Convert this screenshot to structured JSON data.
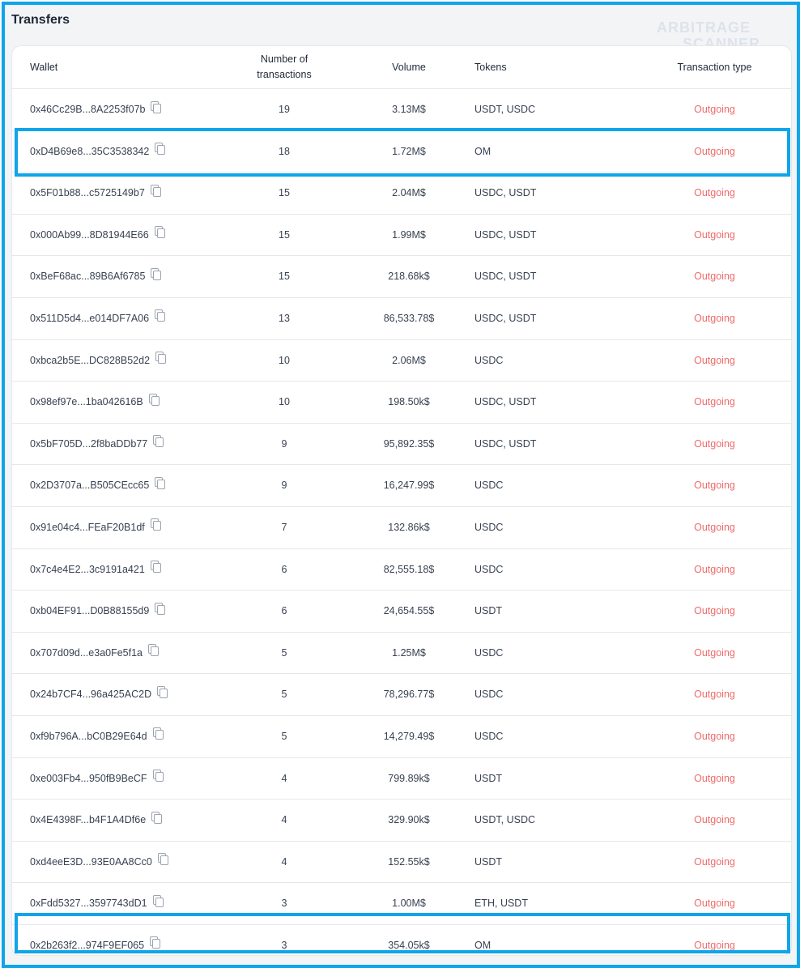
{
  "section": {
    "title": "Transfers"
  },
  "watermark": {
    "line1": "ARBITRAGE",
    "line2": "SCANNER"
  },
  "columns": {
    "wallet": "Wallet",
    "num_transactions": "Number of transactions",
    "volume": "Volume",
    "tokens": "Tokens",
    "transaction_type": "Transaction type"
  },
  "rows": [
    {
      "wallet": "0x46Cc29B...8A2253f07b",
      "count": "19",
      "volume": "3.13M$",
      "tokens": "USDT, USDC",
      "type": "Outgoing"
    },
    {
      "wallet": "0xD4B69e8...35C3538342",
      "count": "18",
      "volume": "1.72M$",
      "tokens": "OM",
      "type": "Outgoing"
    },
    {
      "wallet": "0x5F01b88...c5725149b7",
      "count": "15",
      "volume": "2.04M$",
      "tokens": "USDC, USDT",
      "type": "Outgoing"
    },
    {
      "wallet": "0x000Ab99...8D81944E66",
      "count": "15",
      "volume": "1.99M$",
      "tokens": "USDC, USDT",
      "type": "Outgoing"
    },
    {
      "wallet": "0xBeF68ac...89B6Af6785",
      "count": "15",
      "volume": "218.68k$",
      "tokens": "USDC, USDT",
      "type": "Outgoing"
    },
    {
      "wallet": "0x511D5d4...e014DF7A06",
      "count": "13",
      "volume": "86,533.78$",
      "tokens": "USDC, USDT",
      "type": "Outgoing"
    },
    {
      "wallet": "0xbca2b5E...DC828B52d2",
      "count": "10",
      "volume": "2.06M$",
      "tokens": "USDC",
      "type": "Outgoing"
    },
    {
      "wallet": "0x98ef97e...1ba042616B",
      "count": "10",
      "volume": "198.50k$",
      "tokens": "USDC, USDT",
      "type": "Outgoing"
    },
    {
      "wallet": "0x5bF705D...2f8baDDb77",
      "count": "9",
      "volume": "95,892.35$",
      "tokens": "USDC, USDT",
      "type": "Outgoing"
    },
    {
      "wallet": "0x2D3707a...B505CEcc65",
      "count": "9",
      "volume": "16,247.99$",
      "tokens": "USDC",
      "type": "Outgoing"
    },
    {
      "wallet": "0x91e04c4...FEaF20B1df",
      "count": "7",
      "volume": "132.86k$",
      "tokens": "USDC",
      "type": "Outgoing"
    },
    {
      "wallet": "0x7c4e4E2...3c9191a421",
      "count": "6",
      "volume": "82,555.18$",
      "tokens": "USDC",
      "type": "Outgoing"
    },
    {
      "wallet": "0xb04EF91...D0B88155d9",
      "count": "6",
      "volume": "24,654.55$",
      "tokens": "USDT",
      "type": "Outgoing"
    },
    {
      "wallet": "0x707d09d...e3a0Fe5f1a",
      "count": "5",
      "volume": "1.25M$",
      "tokens": "USDC",
      "type": "Outgoing"
    },
    {
      "wallet": "0x24b7CF4...96a425AC2D",
      "count": "5",
      "volume": "78,296.77$",
      "tokens": "USDC",
      "type": "Outgoing"
    },
    {
      "wallet": "0xf9b796A...bC0B29E64d",
      "count": "5",
      "volume": "14,279.49$",
      "tokens": "USDC",
      "type": "Outgoing"
    },
    {
      "wallet": "0xe003Fb4...950fB9BeCF",
      "count": "4",
      "volume": "799.89k$",
      "tokens": "USDT",
      "type": "Outgoing"
    },
    {
      "wallet": "0x4E4398F...b4F1A4Df6e",
      "count": "4",
      "volume": "329.90k$",
      "tokens": "USDT, USDC",
      "type": "Outgoing"
    },
    {
      "wallet": "0xd4eeE3D...93E0AA8Cc0",
      "count": "4",
      "volume": "152.55k$",
      "tokens": "USDT",
      "type": "Outgoing"
    },
    {
      "wallet": "0xFdd5327...3597743dD1",
      "count": "3",
      "volume": "1.00M$",
      "tokens": "ETH, USDT",
      "type": "Outgoing"
    },
    {
      "wallet": "0x2b263f2...974F9EF065",
      "count": "3",
      "volume": "354.05k$",
      "tokens": "OM",
      "type": "Outgoing"
    }
  ],
  "colors": {
    "accent": "#0ea5e9",
    "outgoing": "#ef6b6b"
  }
}
